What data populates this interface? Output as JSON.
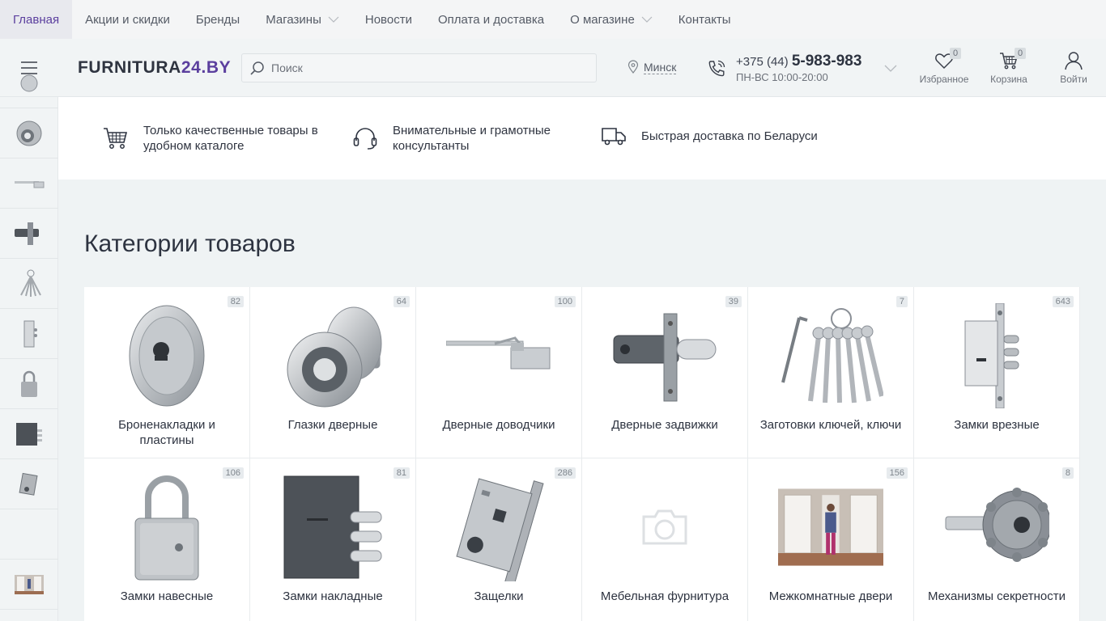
{
  "topnav": {
    "items": [
      {
        "label": "Главная",
        "active": true
      },
      {
        "label": "Акции и скидки"
      },
      {
        "label": "Бренды"
      },
      {
        "label": "Магазины",
        "dropdown": true
      },
      {
        "label": "Новости"
      },
      {
        "label": "Оплата и доставка"
      },
      {
        "label": "О магазине",
        "dropdown": true
      },
      {
        "label": "Контакты"
      }
    ]
  },
  "header": {
    "logo_main": "FURNITURA",
    "logo_accent": "24.BY",
    "search_placeholder": "Поиск",
    "city": "Минск",
    "phone_prefix": "+375 (44)",
    "phone_number": "5-983-983",
    "hours": "ПН-ВС 10:00-20:00",
    "favorites_label": "Избранное",
    "favorites_count": "0",
    "cart_label": "Корзина",
    "cart_count": "0",
    "login_label": "Войти"
  },
  "features": [
    {
      "text": "Только качественные товары в удобном каталоге",
      "icon": "cart-icon"
    },
    {
      "text": "Внимательные и грамотные консультанты",
      "icon": "headset-icon"
    },
    {
      "text": "Быстрая доставка по Беларуси",
      "icon": "truck-icon"
    }
  ],
  "section_title": "Категории товаров",
  "categories": [
    {
      "name": "Броненакладки и пластины",
      "count": "82",
      "icon": "armor-plate-icon"
    },
    {
      "name": "Глазки дверные",
      "count": "64",
      "icon": "door-viewer-icon"
    },
    {
      "name": "Дверные доводчики",
      "count": "100",
      "icon": "door-closer-icon"
    },
    {
      "name": "Дверные задвижки",
      "count": "39",
      "icon": "door-bolt-icon"
    },
    {
      "name": "Заготовки ключей, ключи",
      "count": "7",
      "icon": "keys-icon"
    },
    {
      "name": "Замки врезные",
      "count": "643",
      "icon": "mortise-lock-icon"
    },
    {
      "name": "Замки навесные",
      "count": "106",
      "icon": "padlock-icon"
    },
    {
      "name": "Замки накладные",
      "count": "81",
      "icon": "rim-lock-icon"
    },
    {
      "name": "Защелки",
      "count": "286",
      "icon": "latch-icon"
    },
    {
      "name": "Мебельная фурнитура",
      "count": "",
      "icon": "camera-placeholder-icon"
    },
    {
      "name": "Межкомнатные двери",
      "count": "156",
      "icon": "interior-doors-icon"
    },
    {
      "name": "Механизмы секретности",
      "count": "8",
      "icon": "lock-cylinder-icon"
    }
  ],
  "sidebar_icons": [
    "door-viewer-icon",
    "door-closer-icon",
    "door-bolt-icon",
    "keys-icon",
    "mortise-lock-icon",
    "padlock-icon",
    "rim-lock-icon",
    "latch-icon",
    "furniture-icon",
    "interior-doors-icon"
  ],
  "colors": {
    "accent": "#5b3f9e",
    "background": "#eff3f4",
    "text": "#2d3340",
    "muted": "#6c717a"
  }
}
